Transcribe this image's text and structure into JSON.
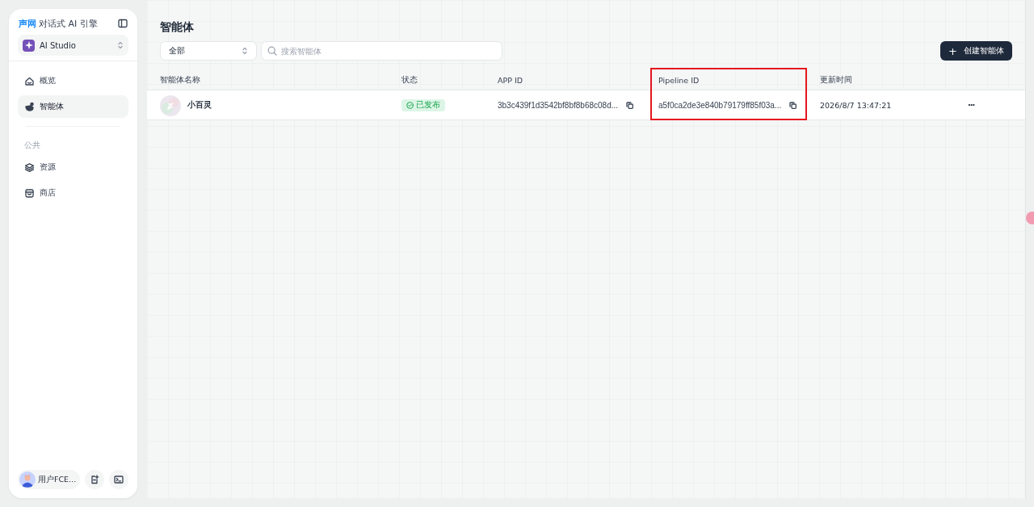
{
  "sidebar": {
    "brand": {
      "logo": "声网",
      "title": "对话式 AI 引擎"
    },
    "workspace": {
      "label": "AI Studio"
    },
    "nav": [
      {
        "label": "概览",
        "selected": false
      },
      {
        "label": "智能体",
        "selected": true
      }
    ],
    "section": {
      "title": "公共",
      "items": [
        {
          "label": "资源",
          "selected": false
        },
        {
          "label": "商店",
          "selected": false
        }
      ]
    },
    "user": {
      "name": "用户FCE..."
    }
  },
  "page": {
    "title": "智能体"
  },
  "filter": {
    "value": "全部"
  },
  "search": {
    "placeholder": "搜索智能体"
  },
  "create_button": {
    "label": "创建智能体",
    "icon": "+"
  },
  "table": {
    "columns": [
      {
        "label": "智能体名称",
        "highlighted": false
      },
      {
        "label": "状态",
        "highlighted": false
      },
      {
        "label": "APP ID",
        "highlighted": false
      },
      {
        "label": "Pipeline ID",
        "highlighted": true
      },
      {
        "label": "更新时间",
        "highlighted": false
      }
    ],
    "rows": [
      {
        "name": "小百灵",
        "status": "已发布",
        "app_id": "3b3c439f1d3542bf8bf8b68c08d...",
        "pipeline_id": "a5f0ca2de3e840b79179ff85f03a...",
        "updated": "2026/8/7 13:47:21",
        "menu": "···"
      }
    ]
  }
}
